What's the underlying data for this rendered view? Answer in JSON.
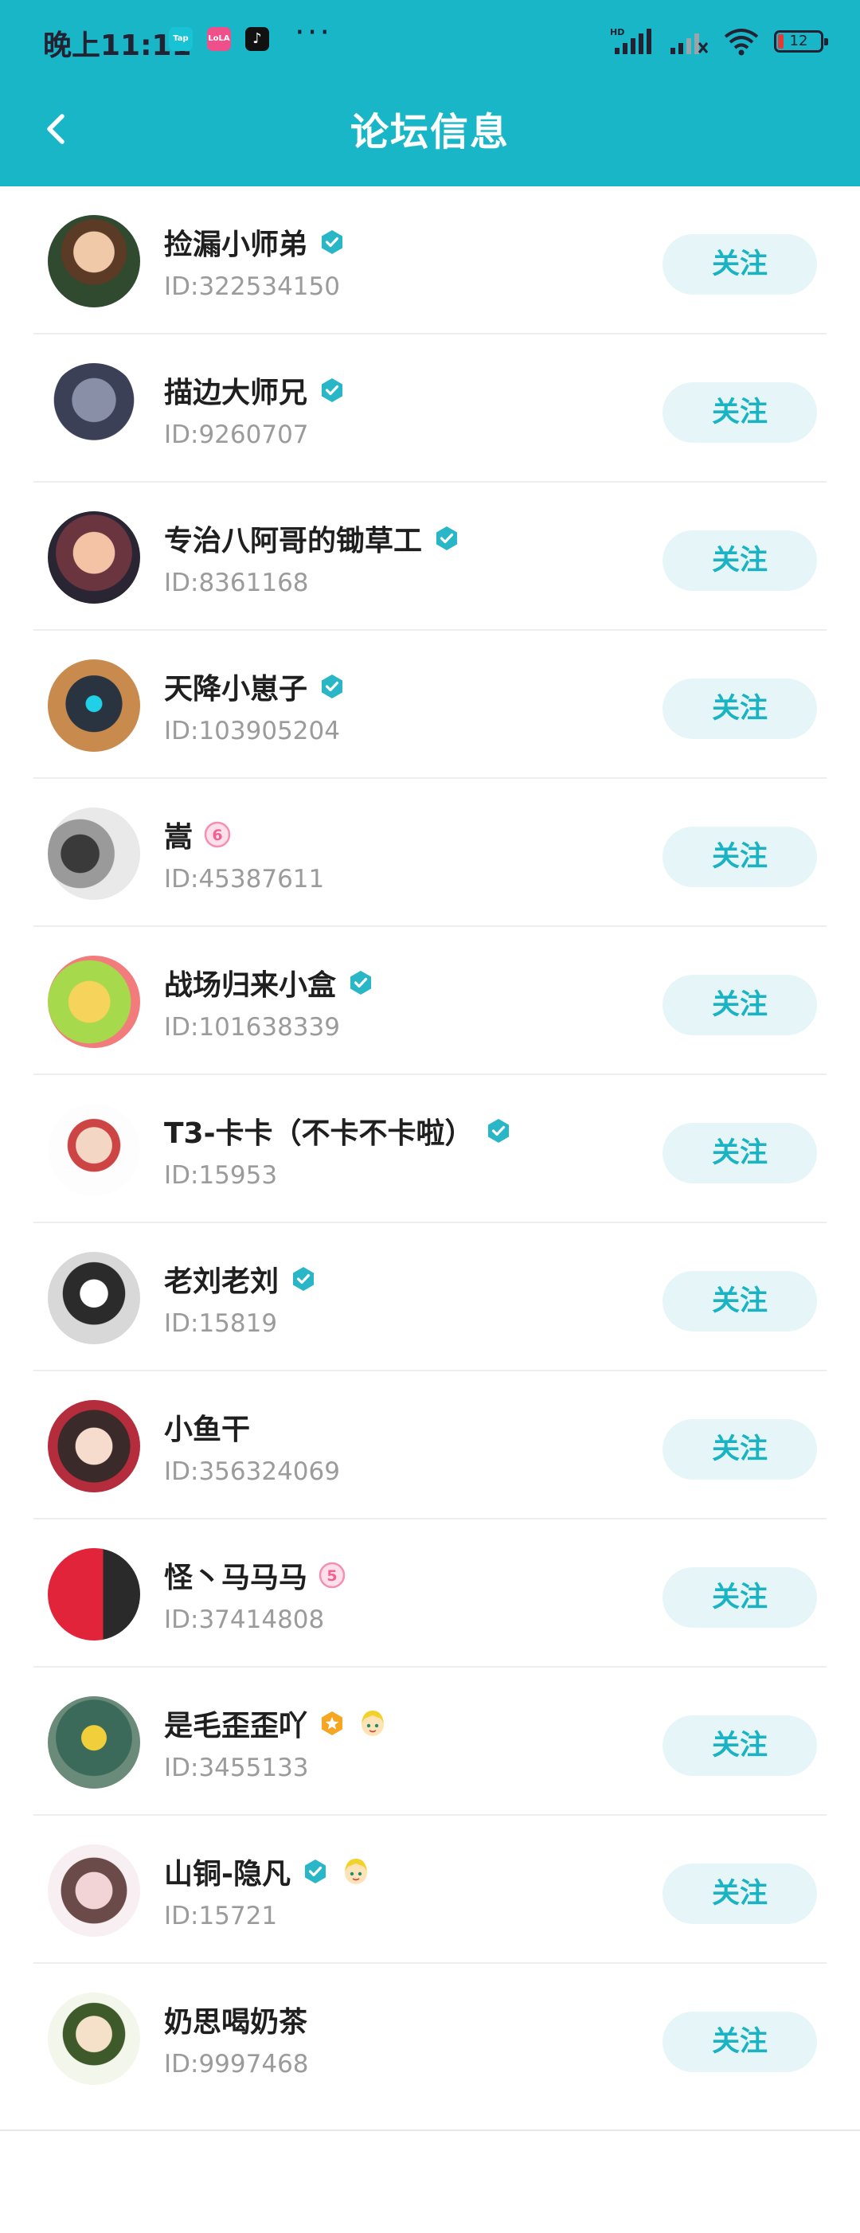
{
  "status_bar": {
    "time": "晚上11:11",
    "app_icons": [
      {
        "name": "taptap-icon",
        "text": "Tap",
        "color": "#19c3d6"
      },
      {
        "name": "lofter-icon",
        "text": "LoLA",
        "color": "#ef4f8b"
      },
      {
        "name": "tiktok-icon",
        "text": "♪",
        "color": "#111111"
      }
    ],
    "more": "···",
    "signal_label": "HD",
    "battery": "12"
  },
  "header": {
    "title": "论坛信息",
    "back_icon": "chevron-left-icon"
  },
  "colors": {
    "header_bg": "#19b6c8",
    "accent": "#19b3c4",
    "follow_bg": "#e6f6f8",
    "verified": "#29b6c6"
  },
  "users": [
    {
      "name": "捡漏小师弟",
      "id": "ID:322534150",
      "badges": [
        "verified-icon"
      ],
      "follow": "关注"
    },
    {
      "name": "描边大师兄",
      "id": "ID:9260707",
      "badges": [
        "verified-icon"
      ],
      "follow": "关注"
    },
    {
      "name": "专治八阿哥的锄草工",
      "id": "ID:8361168",
      "badges": [
        "verified-icon"
      ],
      "follow": "关注"
    },
    {
      "name": "天降小崽子",
      "id": "ID:103905204",
      "badges": [
        "verified-icon"
      ],
      "follow": "关注"
    },
    {
      "name": "嵩",
      "id": "ID:45387611",
      "badges": [
        "level-6-icon"
      ],
      "follow": "关注"
    },
    {
      "name": "战场归来小盒",
      "id": "ID:101638339",
      "badges": [
        "verified-icon"
      ],
      "follow": "关注"
    },
    {
      "name": "T3-卡卡（不卡不卡啦）",
      "id": "ID:15953",
      "badges": [
        "verified-icon"
      ],
      "follow": "关注"
    },
    {
      "name": "老刘老刘",
      "id": "ID:15819",
      "badges": [
        "verified-icon"
      ],
      "follow": "关注"
    },
    {
      "name": "小鱼干",
      "id": "ID:356324069",
      "badges": [],
      "follow": "关注"
    },
    {
      "name": "怪丶马马马",
      "id": "ID:37414808",
      "badges": [
        "level-5-icon"
      ],
      "follow": "关注"
    },
    {
      "name": "是毛歪歪吖",
      "id": "ID:3455133",
      "badges": [
        "star-badge-icon",
        "character-badge-icon"
      ],
      "follow": "关注"
    },
    {
      "name": "山铜-隐凡",
      "id": "ID:15721",
      "badges": [
        "verified-icon",
        "character-badge-icon"
      ],
      "follow": "关注"
    },
    {
      "name": "奶思喝奶茶",
      "id": "ID:9997468",
      "badges": [],
      "follow": "关注"
    }
  ]
}
